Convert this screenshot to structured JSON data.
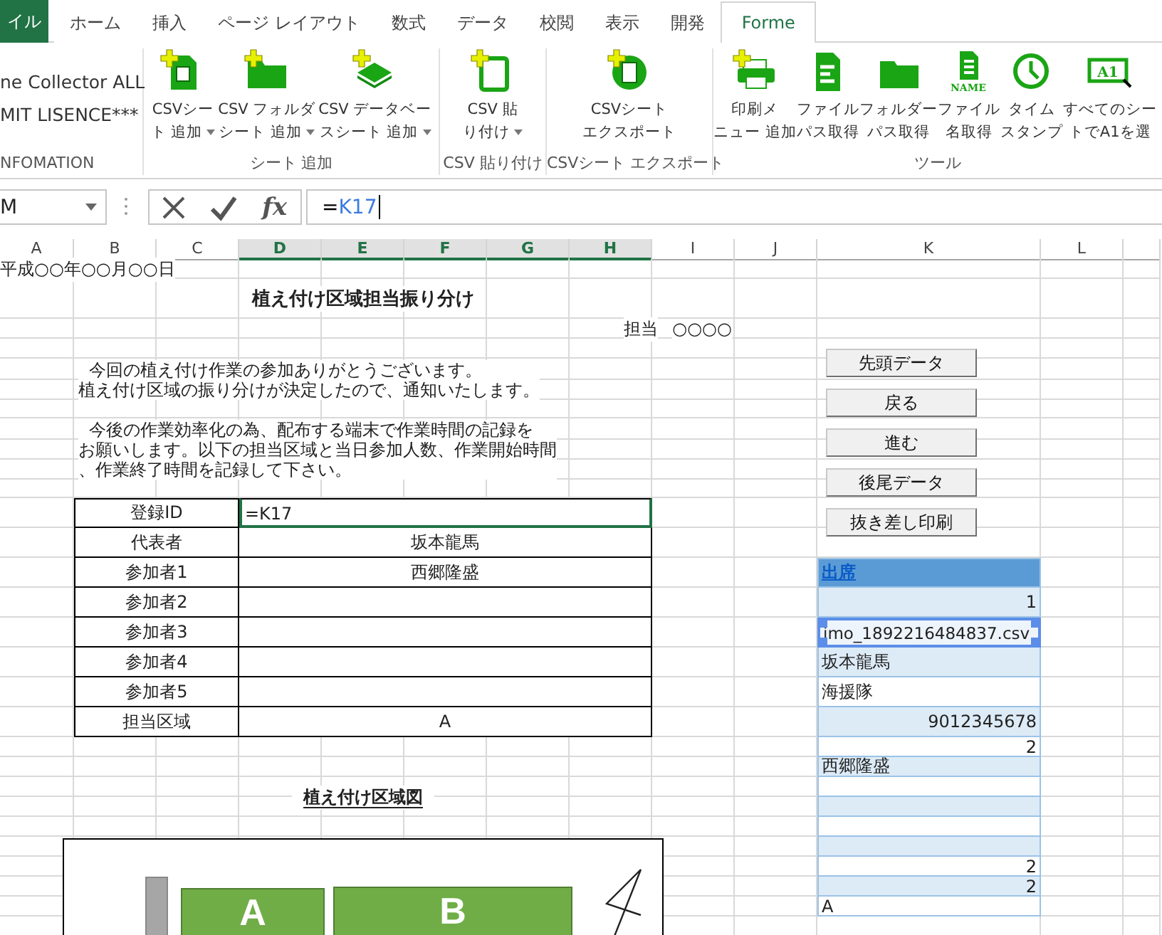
{
  "ribbon_tabs": [
    {
      "label": "イル",
      "kind": "file",
      "selected": false
    },
    {
      "label": "ホーム",
      "kind": "tab",
      "selected": false
    },
    {
      "label": "挿入",
      "kind": "tab",
      "selected": false
    },
    {
      "label": "ページ レイアウト",
      "kind": "tab",
      "selected": false
    },
    {
      "label": "数式",
      "kind": "tab",
      "selected": false
    },
    {
      "label": "データ",
      "kind": "tab",
      "selected": false
    },
    {
      "label": "校閲",
      "kind": "tab",
      "selected": false
    },
    {
      "label": "表示",
      "kind": "tab",
      "selected": false
    },
    {
      "label": "開発",
      "kind": "tab",
      "selected": false
    },
    {
      "label": "Forme",
      "kind": "tab",
      "selected": true
    }
  ],
  "ribbon_groups": [
    {
      "label": "NFOMATION",
      "kind": "info",
      "lines": [
        "ne Collector ALL",
        "MIT LISENCE***"
      ]
    },
    {
      "label": "シート 追加",
      "kind": "buttons",
      "buttons": [
        {
          "lines": [
            "CSVシー",
            "ト 追加"
          ],
          "dropdown": true
        },
        {
          "lines": [
            "CSV フォルダ",
            "シート 追加"
          ],
          "dropdown": true
        },
        {
          "lines": [
            "CSV データベー",
            "スシート 追加"
          ],
          "dropdown": true
        }
      ]
    },
    {
      "label": "CSV 貼り付け",
      "kind": "buttons",
      "buttons": [
        {
          "lines": [
            "CSV 貼",
            "り付け"
          ],
          "dropdown": true
        }
      ]
    },
    {
      "label": "CSVシート エクスポート",
      "kind": "buttons",
      "buttons": [
        {
          "lines": [
            "CSVシート",
            "エクスポート"
          ],
          "dropdown": false
        }
      ]
    },
    {
      "label": "ツール",
      "kind": "buttons",
      "buttons": [
        {
          "lines": [
            "印刷メ",
            "ニュー 追加"
          ],
          "dropdown": false
        },
        {
          "lines": [
            "ファイル",
            "パス取得"
          ],
          "dropdown": false
        },
        {
          "lines": [
            "フォルダー",
            "パス取得"
          ],
          "dropdown": false
        },
        {
          "icon_text": "NAME",
          "lines": [
            "ファイル",
            "名取得"
          ],
          "dropdown": false
        },
        {
          "lines": [
            "タイム",
            "スタンプ"
          ],
          "dropdown": false
        },
        {
          "icon_text": "A1",
          "lines": [
            "すべてのシー",
            "トでA1を選"
          ],
          "dropdown": false
        }
      ]
    }
  ],
  "formula_bar": {
    "name_box": "M",
    "fx_label": "fx",
    "formula_parts": [
      {
        "text": "=",
        "kind": "operator"
      },
      {
        "text": "K17",
        "kind": "reference"
      }
    ]
  },
  "columns": [
    {
      "label": "A",
      "selected": false
    },
    {
      "label": "B",
      "selected": false
    },
    {
      "label": "C",
      "selected": false
    },
    {
      "label": "D",
      "selected": true
    },
    {
      "label": "E",
      "selected": true
    },
    {
      "label": "F",
      "selected": true
    },
    {
      "label": "G",
      "selected": true
    },
    {
      "label": "H",
      "selected": true
    },
    {
      "label": "I",
      "selected": false
    },
    {
      "label": "J",
      "selected": false
    },
    {
      "label": "K",
      "selected": false
    },
    {
      "label": "L",
      "selected": false
    }
  ],
  "sheet": {
    "date": "平成○○年○○月○○日",
    "title": "植え付け区域担当振り分け",
    "assignee_label": "担当",
    "assignee_value": "○○○○",
    "notice": [
      [
        "  今回の植え付け作業の参加ありがとうございます。",
        "植え付け区域の振り分けが決定したので、通知いたします。"
      ],
      [
        "  今後の作業効率化の為、配布する端末で作業時間の記録を",
        "お願いします。以下の担当区域と当日参加人数、作業開始時間",
        "、作業終了時間を記録して下さい。"
      ]
    ]
  },
  "form_rows": [
    {
      "label": "登録ID",
      "value": "=K17",
      "selected": true
    },
    {
      "label": "代表者",
      "value": "坂本龍馬",
      "selected": false
    },
    {
      "label": "参加者1",
      "value": "西郷隆盛",
      "selected": false
    },
    {
      "label": "参加者2",
      "selected": false
    },
    {
      "label": "参加者3",
      "selected": false
    },
    {
      "label": "参加者4",
      "selected": false
    },
    {
      "label": "参加者5",
      "selected": false
    },
    {
      "label": "担当区域",
      "value": "A",
      "selected": false
    }
  ],
  "map": {
    "title": "植え付け区域図",
    "areas": [
      {
        "label": "A"
      },
      {
        "label": "B"
      }
    ]
  },
  "buttons": [
    "先頭データ",
    "戻る",
    "進む",
    "後尾データ",
    "抜き差し印刷"
  ],
  "attendance": {
    "header": "出席",
    "items": [
      {
        "value": "1",
        "kind": "number",
        "highlighted": false
      },
      {
        "value": "imo_1892216484837.csv",
        "kind": "text",
        "highlighted": true
      },
      {
        "value": "坂本龍馬",
        "kind": "text",
        "highlighted": false
      },
      {
        "value": "海援隊",
        "kind": "text",
        "highlighted": false
      },
      {
        "value": "9012345678",
        "kind": "number",
        "highlighted": false
      },
      {
        "value": "2",
        "kind": "number",
        "highlighted": false
      },
      {
        "value": "西郷隆盛",
        "kind": "text",
        "highlighted": false
      },
      {
        "kind": "empty",
        "highlighted": false
      },
      {
        "kind": "empty",
        "highlighted": false
      },
      {
        "kind": "empty",
        "highlighted": false
      },
      {
        "kind": "empty",
        "highlighted": false
      },
      {
        "value": "2",
        "kind": "number",
        "highlighted": false
      },
      {
        "value": "2",
        "kind": "number",
        "highlighted": false
      },
      {
        "value": "A",
        "kind": "text",
        "highlighted": false
      }
    ]
  }
}
